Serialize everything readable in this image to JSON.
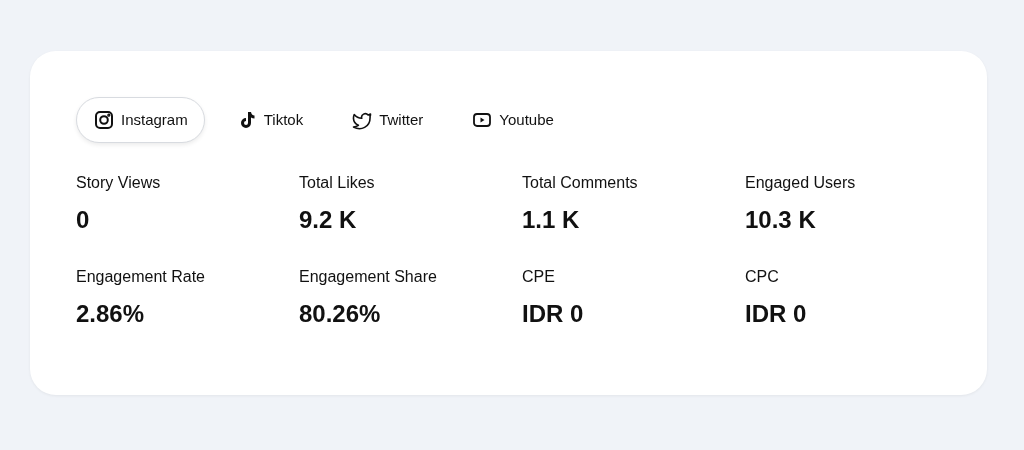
{
  "tabs": [
    {
      "label": "Instagram",
      "kind": "instagram",
      "selected": true
    },
    {
      "label": "Tiktok",
      "kind": "tiktok",
      "selected": false
    },
    {
      "label": "Twitter",
      "kind": "twitter",
      "selected": false
    },
    {
      "label": "Youtube",
      "kind": "youtube",
      "selected": false
    }
  ],
  "metrics": [
    {
      "label": "Story Views",
      "value": "0"
    },
    {
      "label": "Total Likes",
      "value": "9.2 K"
    },
    {
      "label": "Total Comments",
      "value": "1.1 K"
    },
    {
      "label": "Engaged Users",
      "value": "10.3 K"
    },
    {
      "label": "Engagement Rate",
      "value": "2.86%"
    },
    {
      "label": "Engagement Share",
      "value": "80.26%"
    },
    {
      "label": "CPE",
      "value": "IDR 0"
    },
    {
      "label": "CPC",
      "value": "IDR 0"
    }
  ]
}
